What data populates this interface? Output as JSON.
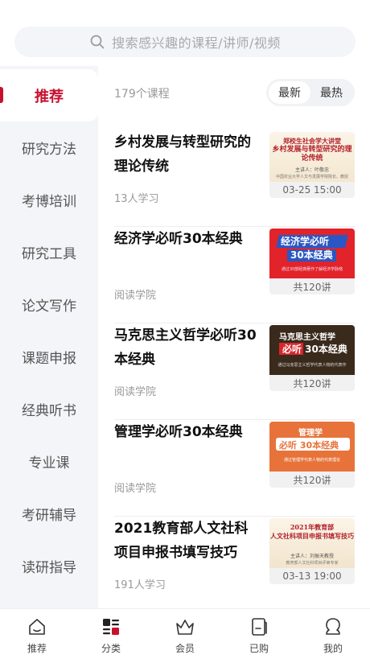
{
  "search": {
    "placeholder": "搜索感兴趣的课程/讲师/视频"
  },
  "sidebar": {
    "items": [
      {
        "label": "推荐",
        "active": true
      },
      {
        "label": "研究方法"
      },
      {
        "label": "考博培训"
      },
      {
        "label": "研究工具"
      },
      {
        "label": "论文写作"
      },
      {
        "label": "课题申报"
      },
      {
        "label": "经典听书"
      },
      {
        "label": "专业课"
      },
      {
        "label": "考研辅导"
      },
      {
        "label": "读研指导"
      }
    ]
  },
  "content": {
    "count": "179个课程",
    "sort": {
      "options": [
        "最新",
        "最热"
      ],
      "selected": "最新"
    },
    "courses": [
      {
        "title": "乡村发展与转型研究的理论传统",
        "meta": "13人学习",
        "caption": "03-25 15:00",
        "thumb": {
          "l1": "郑校生社会学大讲堂",
          "l2": "乡村发展与转型研究的理论传统",
          "l3": "主讲人：叶敬忠",
          "l4": "中国农业大学人文与发展学院院长、教授"
        }
      },
      {
        "title": "经济学必听30本经典",
        "meta": "阅读学院",
        "caption": "共120讲",
        "thumb": {
          "t1": "经济学必听",
          "t2": "30本经典",
          "t3": "通过30部经典著作了解经济学脉络"
        }
      },
      {
        "title": "马克思主义哲学必听30本经典",
        "meta": "阅读学院",
        "caption": "共120讲",
        "thumb": {
          "t1": "马克思主义哲学",
          "t2": "必听 30本经典",
          "t3": "通过马克思主义哲学代表人物的代表作"
        }
      },
      {
        "title": "管理学必听30本经典",
        "meta": "阅读学院",
        "caption": "共120讲",
        "thumb": {
          "t1": "管理学",
          "t2": "必听 30本经典",
          "t3": "通过管理学代表人物的代表理论"
        }
      },
      {
        "title": "2021教育部人文社科项目申报书填写技巧",
        "meta": "191人学习",
        "caption": "03-13 19:00",
        "thumb": {
          "t1": "2021年教育部",
          "t2": "人文社科项目申报书填写技巧",
          "t3": "主讲人：刘振天教授",
          "t4": "教育部人文社科项目评审专家"
        }
      }
    ]
  },
  "tabbar": {
    "items": [
      {
        "label": "推荐",
        "icon": "home-icon"
      },
      {
        "label": "分类",
        "icon": "category-icon",
        "active": true
      },
      {
        "label": "会员",
        "icon": "crown-icon"
      },
      {
        "label": "已购",
        "icon": "purchased-icon"
      },
      {
        "label": "我的",
        "icon": "profile-icon"
      }
    ]
  },
  "colors": {
    "accent": "#c8102e",
    "sidebar_bg": "#f4f5f8"
  }
}
